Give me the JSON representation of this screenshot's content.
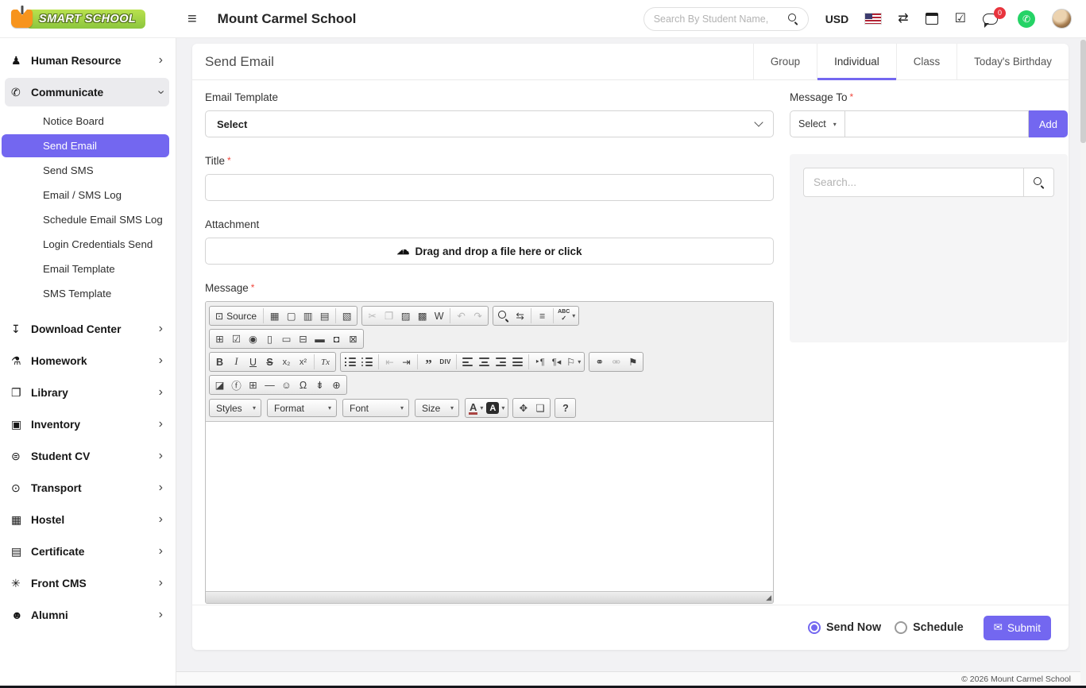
{
  "brand": {
    "logo_text": "SMART SCHOOL"
  },
  "header": {
    "school_name": "Mount Carmel School",
    "search_placeholder": "Search By Student Name,",
    "currency": "USD",
    "chat_badge": "0"
  },
  "sidebar": {
    "items": [
      {
        "label": "Human Resource",
        "icon": "sitemap-icon"
      },
      {
        "label": "Communicate",
        "icon": "megaphone-icon",
        "expanded": true
      },
      {
        "label": "Download Center",
        "icon": "download-icon"
      },
      {
        "label": "Homework",
        "icon": "flask-icon"
      },
      {
        "label": "Library",
        "icon": "book-icon"
      },
      {
        "label": "Inventory",
        "icon": "inventory-icon"
      },
      {
        "label": "Student CV",
        "icon": "cv-icon"
      },
      {
        "label": "Transport",
        "icon": "bus-icon"
      },
      {
        "label": "Hostel",
        "icon": "building-icon"
      },
      {
        "label": "Certificate",
        "icon": "certificate-icon"
      },
      {
        "label": "Front CMS",
        "icon": "cms-icon"
      },
      {
        "label": "Alumni",
        "icon": "alumni-icon"
      }
    ],
    "communicate_children": [
      "Notice Board",
      "Send Email",
      "Send SMS",
      "Email / SMS Log",
      "Schedule Email SMS Log",
      "Login Credentials Send",
      "Email Template",
      "SMS Template"
    ],
    "active_child": "Send Email"
  },
  "page": {
    "title": "Send Email",
    "tabs": [
      "Group",
      "Individual",
      "Class",
      "Today's Birthday"
    ],
    "active_tab": "Individual"
  },
  "form": {
    "email_template_label": "Email Template",
    "email_template_value": "Select",
    "title_label": "Title",
    "attachment_label": "Attachment",
    "dropzone_text": "Drag and drop a file here or click",
    "message_label": "Message"
  },
  "message_to": {
    "label": "Message To",
    "select_label": "Select",
    "add_label": "Add",
    "search_placeholder": "Search..."
  },
  "editor": {
    "source_label": "Source",
    "spell_label": "ABC",
    "div_label": "DIV",
    "styles_label": "Styles",
    "format_label": "Format",
    "font_label": "Font",
    "size_label": "Size"
  },
  "footer_bar": {
    "send_now": "Send Now",
    "schedule": "Schedule",
    "submit": "Submit"
  },
  "footer": {
    "copyright": "© 2026 Mount Carmel School"
  },
  "colors": {
    "accent": "#7367f0",
    "badge_red": "#e8343d",
    "whatsapp_green": "#25d366",
    "logo_green": "#8cc63e",
    "logo_orange": "#f7941d"
  },
  "icons": {
    "sitemap-icon": "♟",
    "megaphone-icon": "✆",
    "download-icon": "↧",
    "flask-icon": "⚗",
    "book-icon": "❐",
    "inventory-icon": "▣",
    "cv-icon": "⊜",
    "bus-icon": "⊙",
    "building-icon": "▦",
    "certificate-icon": "▤",
    "cms-icon": "✳",
    "alumni-icon": "☻",
    "chevron-right-icon": "›",
    "exchange-icon": "⇄",
    "task-icon": "☑",
    "envelope-icon": "✉",
    "resize-icon": "◢",
    "caret-icon": "▾",
    "cloud-icon": "☁",
    "source-icon": "⊡",
    "save-icon": "▦",
    "new-page-icon": "▢",
    "preview-icon": "▥",
    "print-icon": "▤",
    "templates-icon": "▧",
    "cut-icon": "✂",
    "copy-icon": "❐",
    "paste-icon": "▨",
    "paste-text-icon": "▩",
    "paste-word-icon": "W",
    "undo-icon": "↶",
    "redo-icon": "↷",
    "replace-icon": "⇆",
    "select-all-icon": "≡",
    "check-icon": "✓",
    "form-icon": "⊞",
    "checkbox-icon": "☑",
    "radio-icon": "◉",
    "text-field-icon": "▯",
    "textarea-icon": "▭",
    "select-field-icon": "⊟",
    "button-icon": "▬",
    "image-button-icon": "◘",
    "hidden-field-icon": "⊠",
    "bold-icon": "B",
    "italic-icon": "I",
    "underline-icon": "U",
    "strike-icon": "S",
    "subscript-icon": "x₂",
    "superscript-icon": "x²",
    "remove-format-icon": "Tx",
    "outdent-icon": "⇤",
    "indent-icon": "⇥",
    "blockquote-icon": "”",
    "ltr-icon": "‣¶",
    "rtl-icon": "¶◂",
    "language-icon": "⚐",
    "link-icon": "⚭",
    "unlink-icon": "⚮",
    "anchor-icon": "⚑",
    "image-icon": "◪",
    "flash-icon": "ⓕ",
    "table-icon": "⊞",
    "hr-icon": "―",
    "smiley-icon": "☺",
    "special-char-icon": "Ω",
    "page-break-icon": "⇟",
    "iframe-icon": "⊕",
    "text-color-icon": "A",
    "bg-color-icon": "A",
    "maximize-icon": "✥",
    "show-blocks-icon": "❏",
    "about-icon": "?"
  }
}
